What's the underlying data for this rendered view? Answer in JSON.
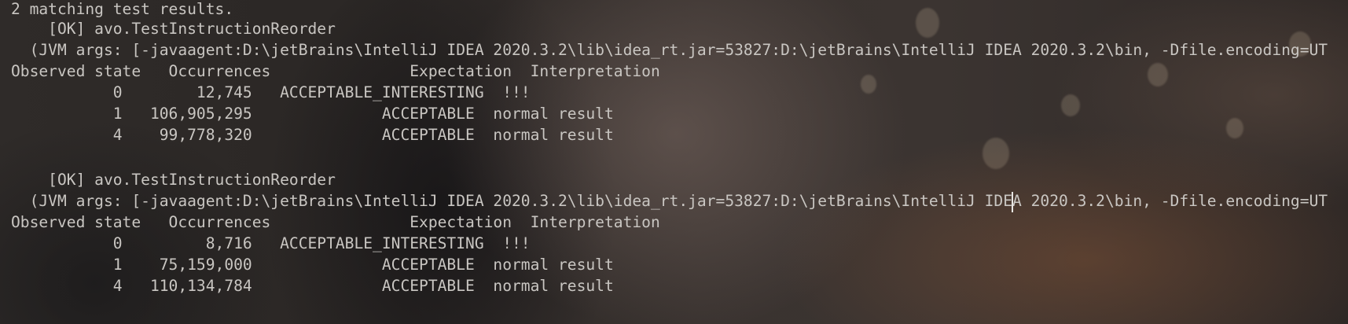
{
  "console": {
    "summary": "2 matching test results.",
    "results": [
      {
        "status_line": "    [OK] avo.TestInstructionReorder",
        "jvm_args_line": "  (JVM args: [-javaagent:D:\\jetBrains\\IntelliJ IDEA 2020.3.2\\lib\\idea_rt.jar=53827:D:\\jetBrains\\IntelliJ IDEA 2020.3.2\\bin, -Dfile.encoding=UT",
        "table_header": "Observed state   Occurrences               Expectation  Interpretation",
        "rows": [
          "           0        12,745   ACCEPTABLE_INTERESTING  !!!",
          "           1   106,905,295              ACCEPTABLE  normal result",
          "           4    99,778,320              ACCEPTABLE  normal result"
        ]
      },
      {
        "status_line": "    [OK] avo.TestInstructionReorder",
        "jvm_args_line": "  (JVM args: [-javaagent:D:\\jetBrains\\IntelliJ IDEA 2020.3.2\\lib\\idea_rt.jar=53827:D:\\jetBrains\\IntelliJ IDEA 2020.3.2\\bin, -Dfile.encoding=UT",
        "table_header": "Observed state   Occurrences               Expectation  Interpretation",
        "rows": [
          "           0         8,716   ACCEPTABLE_INTERESTING  !!!",
          "           1    75,159,000              ACCEPTABLE  normal result",
          "           4   110,134,784              ACCEPTABLE  normal result"
        ]
      }
    ]
  },
  "colors": {
    "text": "#c9c6c2",
    "background": "#2a2624"
  }
}
